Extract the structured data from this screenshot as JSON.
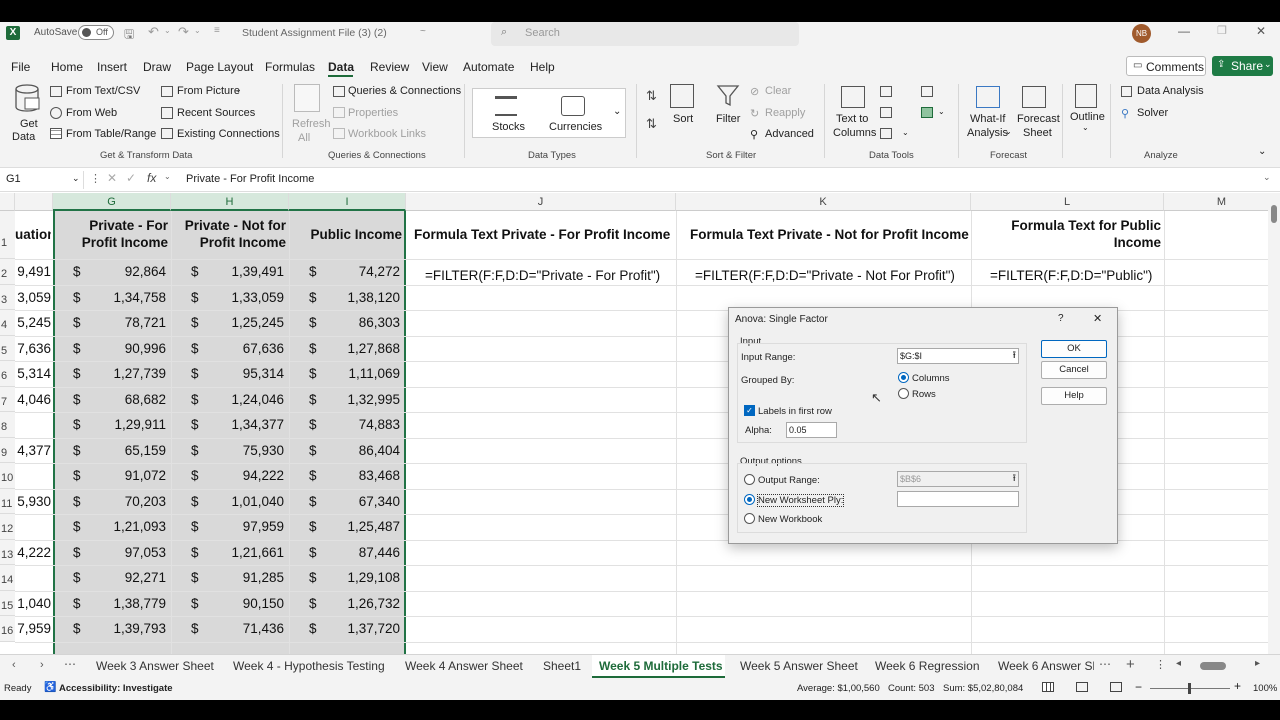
{
  "titlebar": {
    "autosave": "AutoSave",
    "toggle": "Off",
    "filename": "Student Assignment File (3) (2)",
    "filename_suffix": "~",
    "search_placeholder": "Search",
    "user_initials": "NB"
  },
  "menu": {
    "items": [
      "File",
      "Home",
      "Insert",
      "Draw",
      "Page Layout",
      "Formulas",
      "Data",
      "Review",
      "View",
      "Automate",
      "Help"
    ],
    "active": "Data",
    "comments": "Comments",
    "share": "Share"
  },
  "ribbon": {
    "get_data": "Get",
    "get_data2": "Data",
    "from_text_csv": "From Text/CSV",
    "from_web": "From Web",
    "from_table": "From Table/Range",
    "from_picture": "From Picture",
    "recent_sources": "Recent Sources",
    "existing_connections": "Existing Connections",
    "group_get": "Get & Transform Data",
    "refresh": "Refresh",
    "refresh2": "All",
    "queries_connections": "Queries & Connections",
    "properties": "Properties",
    "workbook_links": "Workbook Links",
    "group_queries": "Queries & Connections",
    "stocks": "Stocks",
    "currencies": "Currencies",
    "group_types": "Data Types",
    "sort": "Sort",
    "filter": "Filter",
    "clear": "Clear",
    "reapply": "Reapply",
    "advanced": "Advanced",
    "group_sort": "Sort & Filter",
    "text_to": "Text to",
    "columns": "Columns",
    "group_tools": "Data Tools",
    "whatif": "What-If",
    "analysis": "Analysis",
    "forecast": "Forecast",
    "sheet": "Sheet",
    "group_forecast": "Forecast",
    "outline": "Outline",
    "data_analysis": "Data Analysis",
    "solver": "Solver",
    "group_analyze": "Analyze"
  },
  "formula": {
    "namebox": "G1",
    "fx": "fx",
    "content": "Private - For Profit Income"
  },
  "columns": [
    "G",
    "H",
    "I",
    "J",
    "K",
    "L",
    "M"
  ],
  "headers": {
    "f": "uation",
    "g1": "Private - For",
    "g2": "Profit Income",
    "h1": "Private - Not for",
    "h2": "Profit Income",
    "i": "Public Income",
    "j": "Formula Text  Private - For Profit Income",
    "k": "Formula Text Private - Not for Profit Income",
    "l1": "Formula Text for Public",
    "l2": "Income"
  },
  "formulas": {
    "j": "=FILTER(F:F,D:D=\"Private - For Profit\")",
    "k": "=FILTER(F:F,D:D=\"Private - Not For Profit\")",
    "l": "=FILTER(F:F,D:D=\"Public\")"
  },
  "rows": [
    {
      "n": "2",
      "f": "9,491",
      "g": "92,864",
      "h": "1,39,491",
      "i": "74,272"
    },
    {
      "n": "3",
      "f": "3,059",
      "g": "1,34,758",
      "h": "1,33,059",
      "i": "1,38,120"
    },
    {
      "n": "4",
      "f": "5,245",
      "g": "78,721",
      "h": "1,25,245",
      "i": "86,303"
    },
    {
      "n": "5",
      "f": "7,636",
      "g": "90,996",
      "h": "67,636",
      "i": "1,27,868"
    },
    {
      "n": "6",
      "f": "5,314",
      "g": "1,27,739",
      "h": "95,314",
      "i": "1,11,069"
    },
    {
      "n": "7",
      "f": "4,046",
      "g": "68,682",
      "h": "1,24,046",
      "i": "1,32,995"
    },
    {
      "n": "8",
      "f": "",
      "g": "1,29,911",
      "h": "1,34,377",
      "i": "74,883"
    },
    {
      "n": "9",
      "f": "4,377",
      "g": "65,159",
      "h": "75,930",
      "i": "86,404"
    },
    {
      "n": "10",
      "f": "",
      "g": "91,072",
      "h": "94,222",
      "i": "83,468"
    },
    {
      "n": "11",
      "f": "5,930",
      "g": "70,203",
      "h": "1,01,040",
      "i": "67,340"
    },
    {
      "n": "12",
      "f": "",
      "g": "1,21,093",
      "h": "97,959",
      "i": "1,25,487"
    },
    {
      "n": "13",
      "f": "4,222",
      "g": "97,053",
      "h": "1,21,661",
      "i": "87,446"
    },
    {
      "n": "14",
      "f": "",
      "g": "92,271",
      "h": "91,285",
      "i": "1,29,108"
    },
    {
      "n": "15",
      "f": "1,040",
      "g": "1,38,779",
      "h": "90,150",
      "i": "1,26,732"
    },
    {
      "n": "16",
      "f": "7,959",
      "g": "1,39,793",
      "h": "71,436",
      "i": "1,37,720"
    }
  ],
  "row1": "1",
  "currency": "$",
  "dialog": {
    "title": "Anova: Single Factor",
    "help_q": "?",
    "close": "✕",
    "input": "Input",
    "input_range": "Input Range:",
    "input_range_val": "$G:$I",
    "grouped_by": "Grouped By:",
    "columns": "Columns",
    "rows": "Rows",
    "labels": "Labels in first row",
    "alpha": "Alpha:",
    "alpha_val": "0.05",
    "output_options": "Output options",
    "output_range": "Output Range:",
    "output_range_val": "$B$6",
    "new_ws": "New Worksheet Ply:",
    "new_wb": "New Workbook",
    "ok": "OK",
    "cancel": "Cancel",
    "help": "Help"
  },
  "tabs": [
    "Week 3 Answer Sheet",
    "Week 4 - Hypothesis Testing",
    "Week 4 Answer Sheet",
    "Sheet1",
    "Week 5 Multiple Tests",
    "Week 5 Answer Sheet",
    "Week 6 Regression",
    "Week 6 Answer Sh"
  ],
  "active_tab": "Week 5 Multiple Tests",
  "status": {
    "ready": "Ready",
    "accessibility": "Accessibility: Investigate",
    "average": "Average: $1,00,560",
    "count": "Count: 503",
    "sum": "Sum: $5,02,80,084",
    "zoom": "100%"
  }
}
